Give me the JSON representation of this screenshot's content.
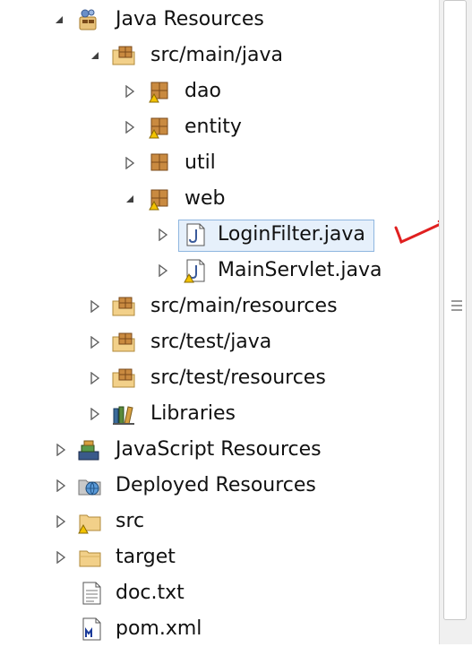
{
  "tree": {
    "java_resources": "Java Resources",
    "src_main_java": "src/main/java",
    "pkg_dao": "dao",
    "pkg_entity": "entity",
    "pkg_util": "util",
    "pkg_web": "web",
    "file_loginfilter": "LoginFilter.java",
    "file_mainservlet": "MainServlet.java",
    "src_main_resources": "src/main/resources",
    "src_test_java": "src/test/java",
    "src_test_resources": "src/test/resources",
    "libraries": "Libraries",
    "javascript_resources": "JavaScript Resources",
    "deployed_resources": "Deployed Resources",
    "src": "src",
    "target": "target",
    "doc_txt": "doc.txt",
    "pom_xml": "pom.xml"
  },
  "colors": {
    "selection_border": "#8fb6e0",
    "annotation": "#e02020"
  }
}
